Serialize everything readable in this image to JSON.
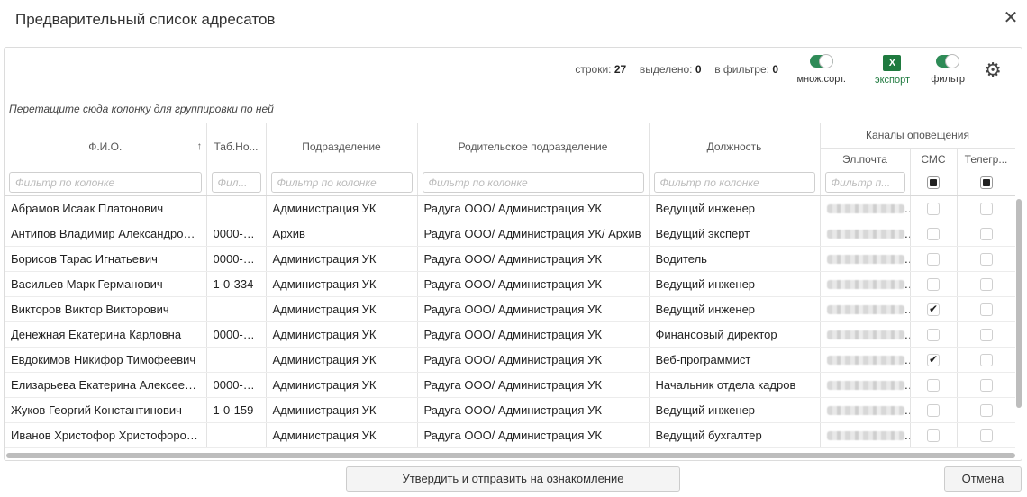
{
  "dialog": {
    "title": "Предварительный список адресатов",
    "close": "✕"
  },
  "toolbar": {
    "rows_label": "строки:",
    "rows_value": "27",
    "selected_label": "выделено:",
    "selected_value": "0",
    "filtered_label": "в фильтре:",
    "filtered_value": "0",
    "multisort_label": "множ.сорт.",
    "export_label": "экспорт",
    "export_icon_text": "X",
    "filter_label": "фильтр",
    "settings_icon": "⚙"
  },
  "group_hint": "Перетащите сюда колонку для группировки по ней",
  "columns": {
    "fio": "Ф.И.О.",
    "tab": "Таб.Но...",
    "dept": "Подразделение",
    "parent": "Родительское подразделение",
    "position": "Должность",
    "channels": "Каналы оповещения",
    "email": "Эл.почта",
    "sms": "СМС",
    "telegram": "Телегр..."
  },
  "filter_placeholders": {
    "default": "Фильтр по колонке",
    "tab": "Фил...",
    "email": "Фильтр п..."
  },
  "rows": [
    {
      "fio": "Абрамов Исаак Платонович",
      "tab": "",
      "dept": "Администрация УК",
      "parent": "Радуга ООО/ Администрация УК",
      "position": "Ведущий инженер",
      "sms": false,
      "tg": false
    },
    {
      "fio": "Антипов Владимир Александрович",
      "tab": "0000-0...",
      "dept": "Архив",
      "parent": "Радуга ООО/ Администрация УК/ Архив",
      "position": "Ведущий эксперт",
      "sms": false,
      "tg": false
    },
    {
      "fio": "Борисов Тарас Игнатьевич",
      "tab": "0000-0...",
      "dept": "Администрация УК",
      "parent": "Радуга ООО/ Администрация УК",
      "position": "Водитель",
      "sms": false,
      "tg": false
    },
    {
      "fio": "Васильев Марк Германович",
      "tab": "1-0-334",
      "dept": "Администрация УК",
      "parent": "Радуга ООО/ Администрация УК",
      "position": "Ведущий инженер",
      "sms": false,
      "tg": false
    },
    {
      "fio": "Викторов Виктор Викторович",
      "tab": "",
      "dept": "Администрация УК",
      "parent": "Радуга ООО/ Администрация УК",
      "position": "Ведущий инженер",
      "sms": true,
      "tg": false
    },
    {
      "fio": "Денежная Екатерина Карловна",
      "tab": "0000-0...",
      "dept": "Администрация УК",
      "parent": "Радуга ООО/ Администрация УК",
      "position": "Финансовый директор",
      "sms": false,
      "tg": false
    },
    {
      "fio": "Евдокимов Никифор Тимофеевич",
      "tab": "",
      "dept": "Администрация УК",
      "parent": "Радуга ООО/ Администрация УК",
      "position": "Веб-программист",
      "sms": true,
      "tg": false
    },
    {
      "fio": "Елизарьева Екатерина Алексеевна",
      "tab": "0000-0...",
      "dept": "Администрация УК",
      "parent": "Радуга ООО/ Администрация УК",
      "position": "Начальник отдела кадров",
      "sms": false,
      "tg": false
    },
    {
      "fio": "Жуков Георгий Константинович",
      "tab": "1-0-159",
      "dept": "Администрация УК",
      "parent": "Радуга ООО/ Администрация УК",
      "position": "Ведущий инженер",
      "sms": false,
      "tg": false
    },
    {
      "fio": "Иванов Христофор Христофорович",
      "tab": "",
      "dept": "Администрация УК",
      "parent": "Радуга ООО/ Администрация УК",
      "position": "Ведущий бухгалтер",
      "sms": false,
      "tg": false
    }
  ],
  "buttons": {
    "confirm": "Утвердить и отправить на ознакомление",
    "cancel": "Отмена"
  }
}
